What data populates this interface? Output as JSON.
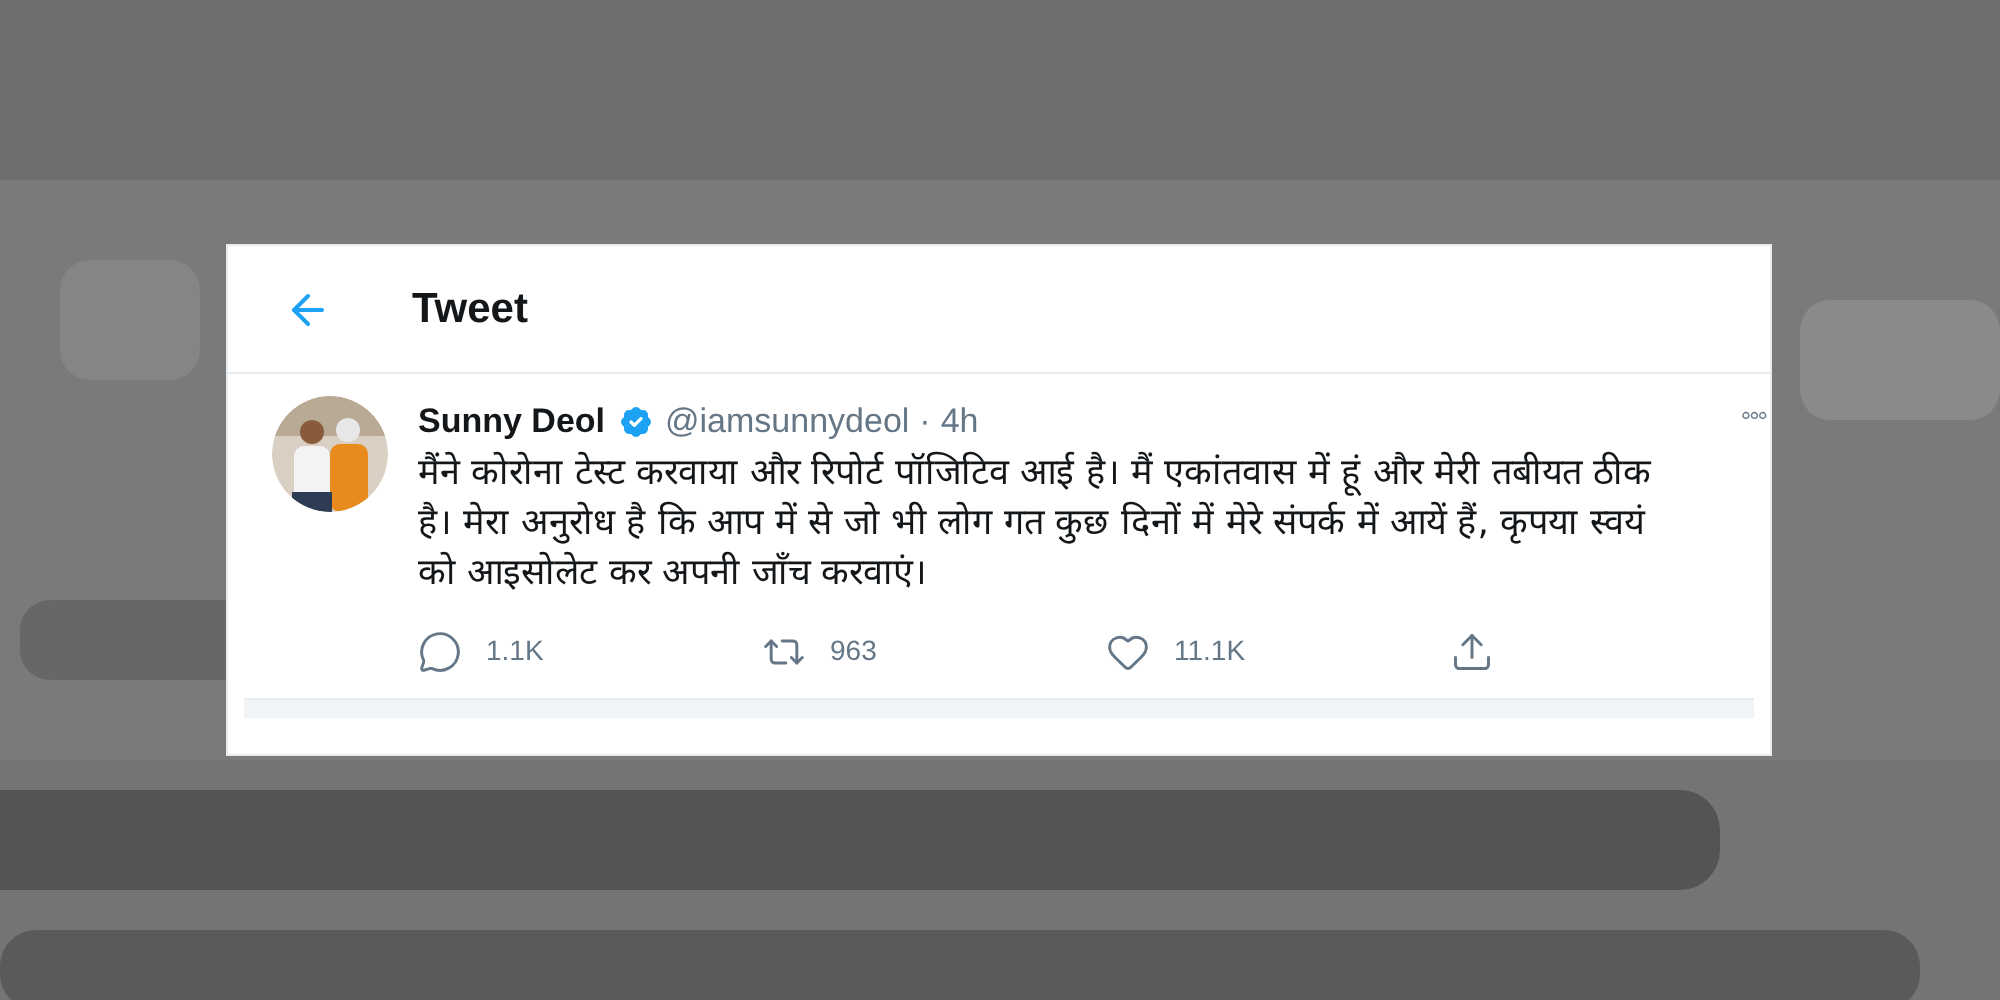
{
  "header": {
    "title": "Tweet"
  },
  "tweet": {
    "name": "Sunny Deol",
    "verified": true,
    "handle": "@iamsunnydeol",
    "separator": "·",
    "time": "4h",
    "more": "°°°",
    "text": "मैंने कोरोना टेस्ट करवाया और रिपोर्ट पॉजिटिव आई है। मैं एकांतवास में हूं और मेरी तबीयत ठीक है। मेरा अनुरोध है कि आप में से जो भी लोग गत कुछ दिनों में मेरे संपर्क में आयें हैं, कृपया स्वयं को आइसोलेट कर अपनी जाँच करवाएं।",
    "actions": [
      {
        "kind": "reply",
        "count": "1.1K"
      },
      {
        "kind": "retweet",
        "count": "963"
      },
      {
        "kind": "like",
        "count": "11.1K"
      },
      {
        "kind": "share"
      }
    ]
  }
}
